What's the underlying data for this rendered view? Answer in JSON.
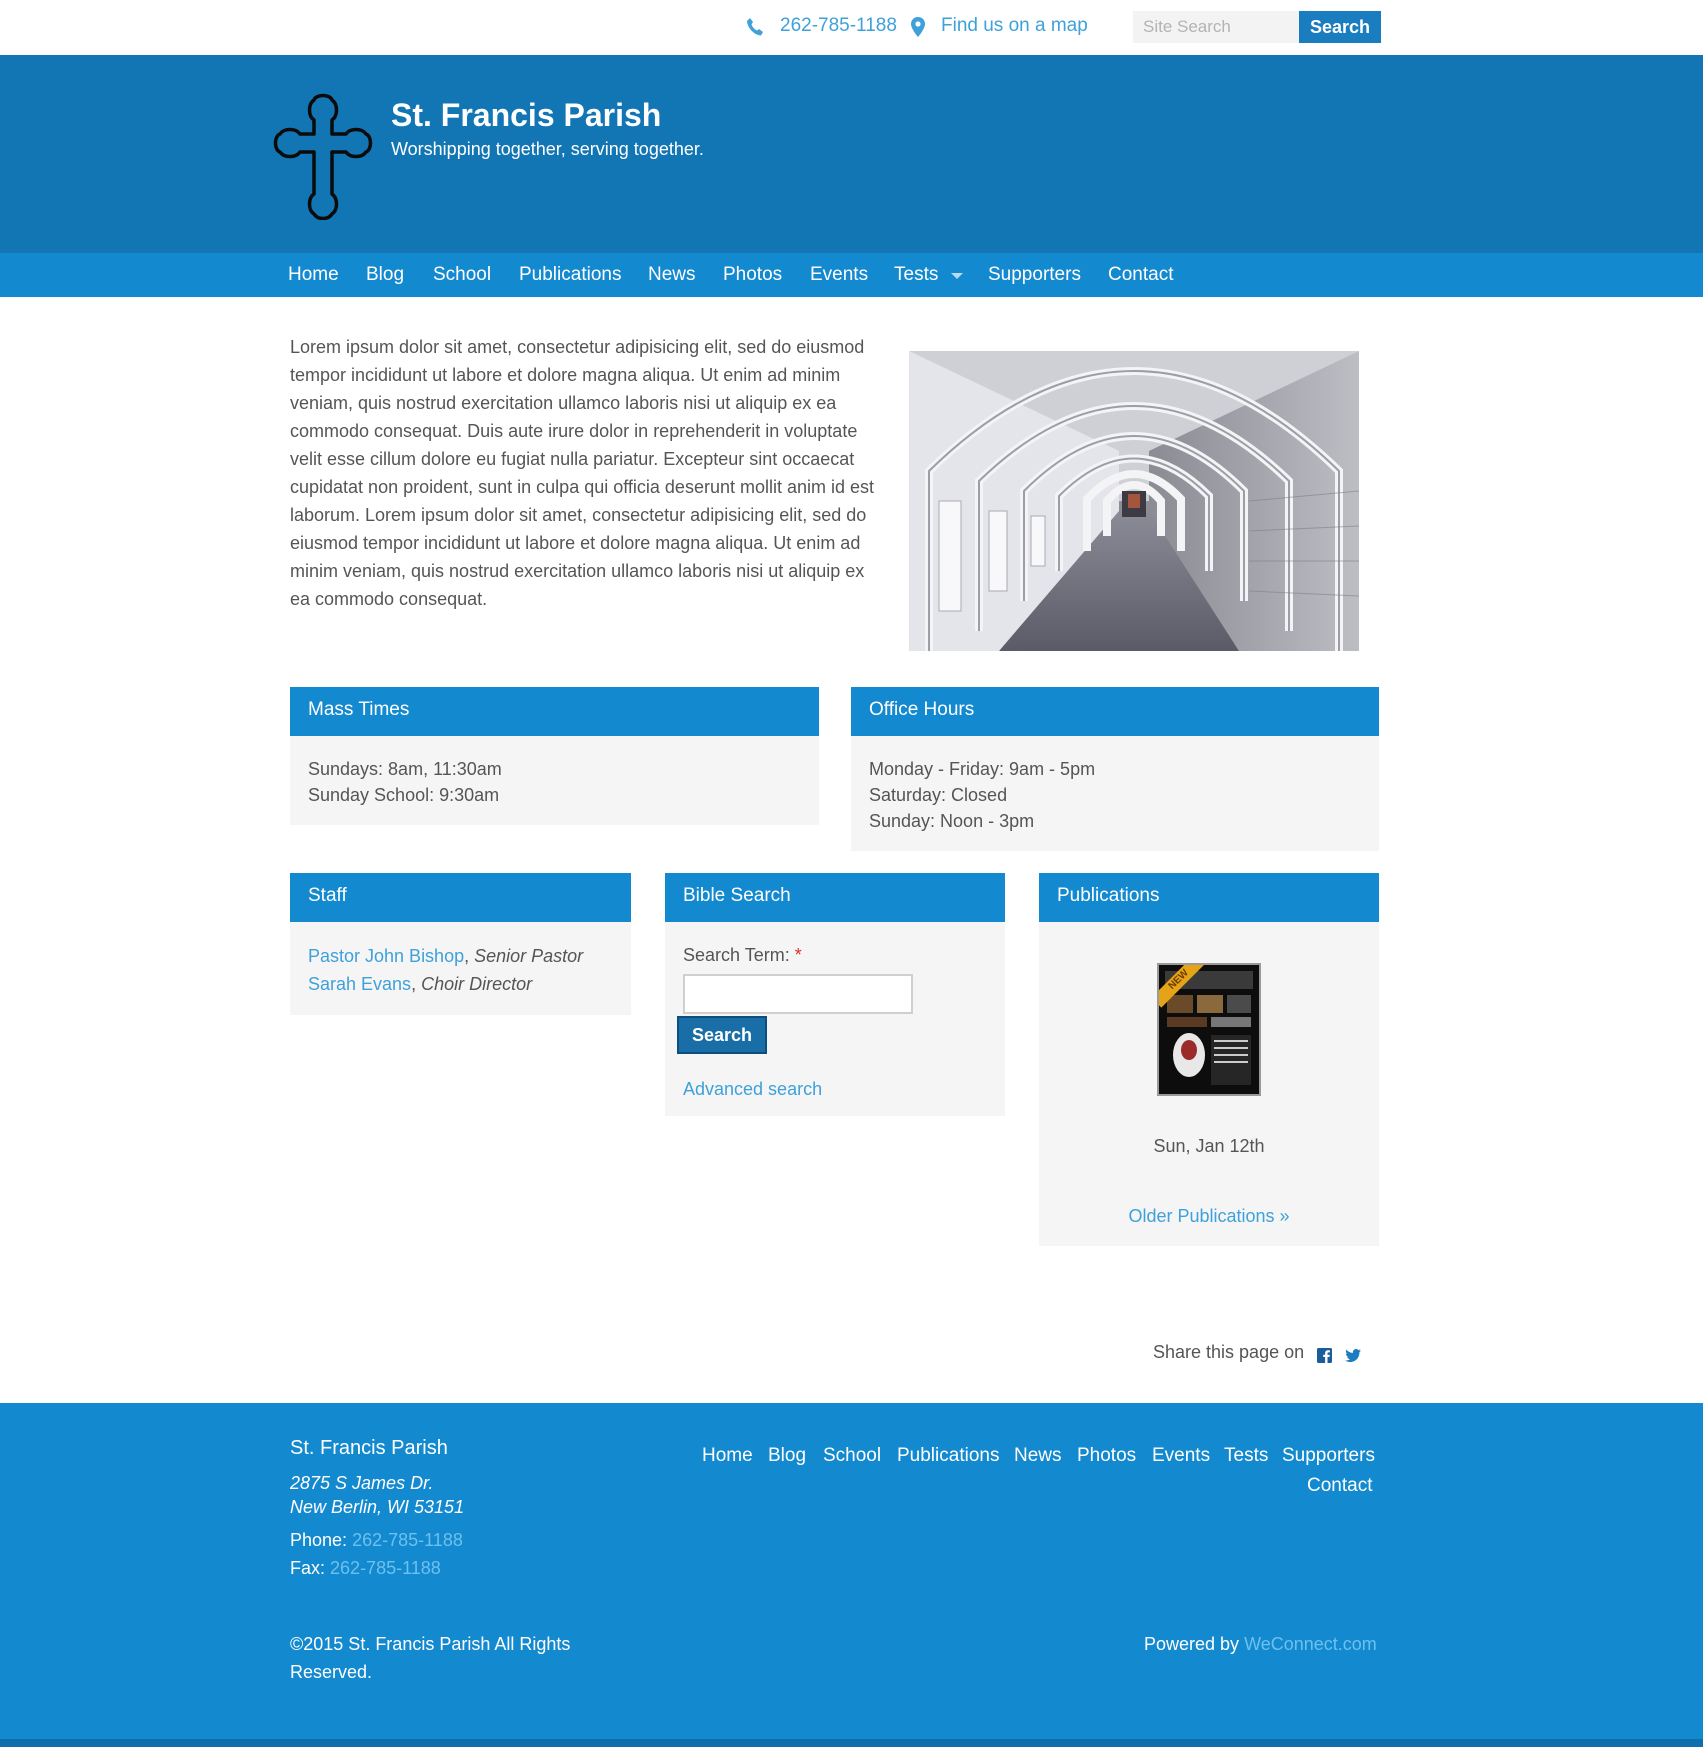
{
  "topbar": {
    "phone": "262-785-1188",
    "map_link": "Find us on a map",
    "search_placeholder": "Site Search",
    "search_button": "Search",
    "phone_icon": "phone-icon",
    "map_icon": "map-pin-icon"
  },
  "header": {
    "title": "St. Francis Parish",
    "slogan": "Worshipping together, serving together.",
    "logo_icon": "cross-icon"
  },
  "nav": {
    "items": [
      "Home",
      "Blog",
      "School",
      "Publications",
      "News",
      "Photos",
      "Events",
      "Tests",
      "Supporters",
      "Contact"
    ]
  },
  "intro": {
    "text": "Lorem ipsum dolor sit amet, consectetur adipisicing elit, sed do eiusmod tempor incididunt ut labore et dolore magna aliqua. Ut enim ad minim veniam, quis nostrud exercitation ullamco laboris nisi ut aliquip ex ea commodo consequat. Duis aute irure dolor in reprehenderit in voluptate velit esse cillum dolore eu fugiat nulla pariatur. Excepteur sint occaecat cupidatat non proident, sunt in culpa qui officia deserunt mollit anim id est laborum. Lorem ipsum dolor sit amet, consectetur adipisicing elit, sed do eiusmod tempor incididunt ut labore et dolore magna aliqua. Ut enim ad minim veniam, quis nostrud exercitation ullamco laboris nisi ut aliquip ex ea commodo consequat."
  },
  "mass_times": {
    "title": "Mass Times",
    "lines": [
      "Sundays: 8am, 11:30am",
      "Sunday School: 9:30am"
    ]
  },
  "office_hours": {
    "title": "Office Hours",
    "lines": [
      "Monday - Friday: 9am - 5pm",
      "Saturday: Closed",
      "Sunday: Noon - 3pm"
    ]
  },
  "staff": {
    "title": "Staff",
    "members": [
      {
        "name": "Pastor John Bishop",
        "role": "Senior Pastor"
      },
      {
        "name": "Sarah Evans",
        "role": "Choir Director"
      }
    ]
  },
  "bible_search": {
    "title": "Bible Search",
    "label": "Search Term:",
    "required_mark": "*",
    "button": "Search",
    "advanced_link": "Advanced search"
  },
  "publications": {
    "title": "Publications",
    "badge": "NEW",
    "date": "Sun, Jan 12th",
    "older_link": "Older Publications »"
  },
  "share": {
    "label": "Share this page on",
    "icons": [
      "facebook-icon",
      "twitter-icon"
    ]
  },
  "footer": {
    "name": "St. Francis Parish",
    "address_line1": "2875 S James Dr.",
    "address_line2": "New Berlin, WI 53151",
    "phone_label": "Phone:",
    "phone": "262-785-1188",
    "fax_label": "Fax:",
    "fax": "262-785-1188",
    "nav": [
      "Home",
      "Blog",
      "School",
      "Publications",
      "News",
      "Photos",
      "Events",
      "Tests",
      "Supporters",
      "Contact"
    ],
    "copyright": "©2015 St. Francis Parish All Rights Reserved.",
    "powered_label": "Powered by",
    "powered_link": "WeConnect.com"
  },
  "colors": {
    "header_blue": "#1275b4",
    "nav_blue": "#1389d0",
    "link_blue": "#3ea1d9",
    "button_blue": "#1a7dc0"
  }
}
